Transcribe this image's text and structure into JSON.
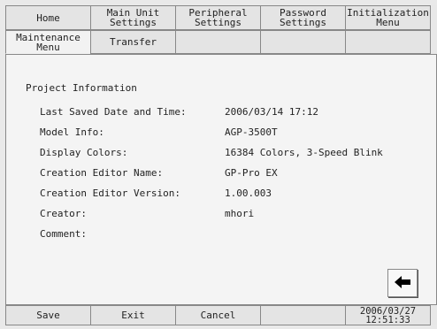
{
  "tabs_row1": [
    {
      "label": "Home"
    },
    {
      "label": "Main Unit\nSettings"
    },
    {
      "label": "Peripheral\nSettings"
    },
    {
      "label": "Password\nSettings"
    },
    {
      "label": "Initialization\nMenu"
    }
  ],
  "tabs_row2": [
    {
      "label": "Maintenance\nMenu"
    },
    {
      "label": "Transfer"
    },
    {
      "label": ""
    },
    {
      "label": ""
    },
    {
      "label": ""
    }
  ],
  "panel": {
    "heading": "Project Information",
    "rows": [
      {
        "label": "Last Saved Date and Time:",
        "value": "2006/03/14 17:12"
      },
      {
        "label": "Model Info:",
        "value": "AGP-3500T"
      },
      {
        "label": "Display Colors:",
        "value": "16384 Colors, 3-Speed Blink"
      },
      {
        "label": "Creation Editor Name:",
        "value": "GP-Pro EX"
      },
      {
        "label": "Creation Editor Version:",
        "value": "1.00.003"
      },
      {
        "label": "Creator:",
        "value": "mhori"
      },
      {
        "label": "Comment:",
        "value": ""
      }
    ],
    "back_icon": "left-arrow-icon"
  },
  "bottom_bar": {
    "save_label": "Save",
    "exit_label": "Exit",
    "cancel_label": "Cancel",
    "date": "2006/03/27",
    "time": "12:51:33"
  }
}
